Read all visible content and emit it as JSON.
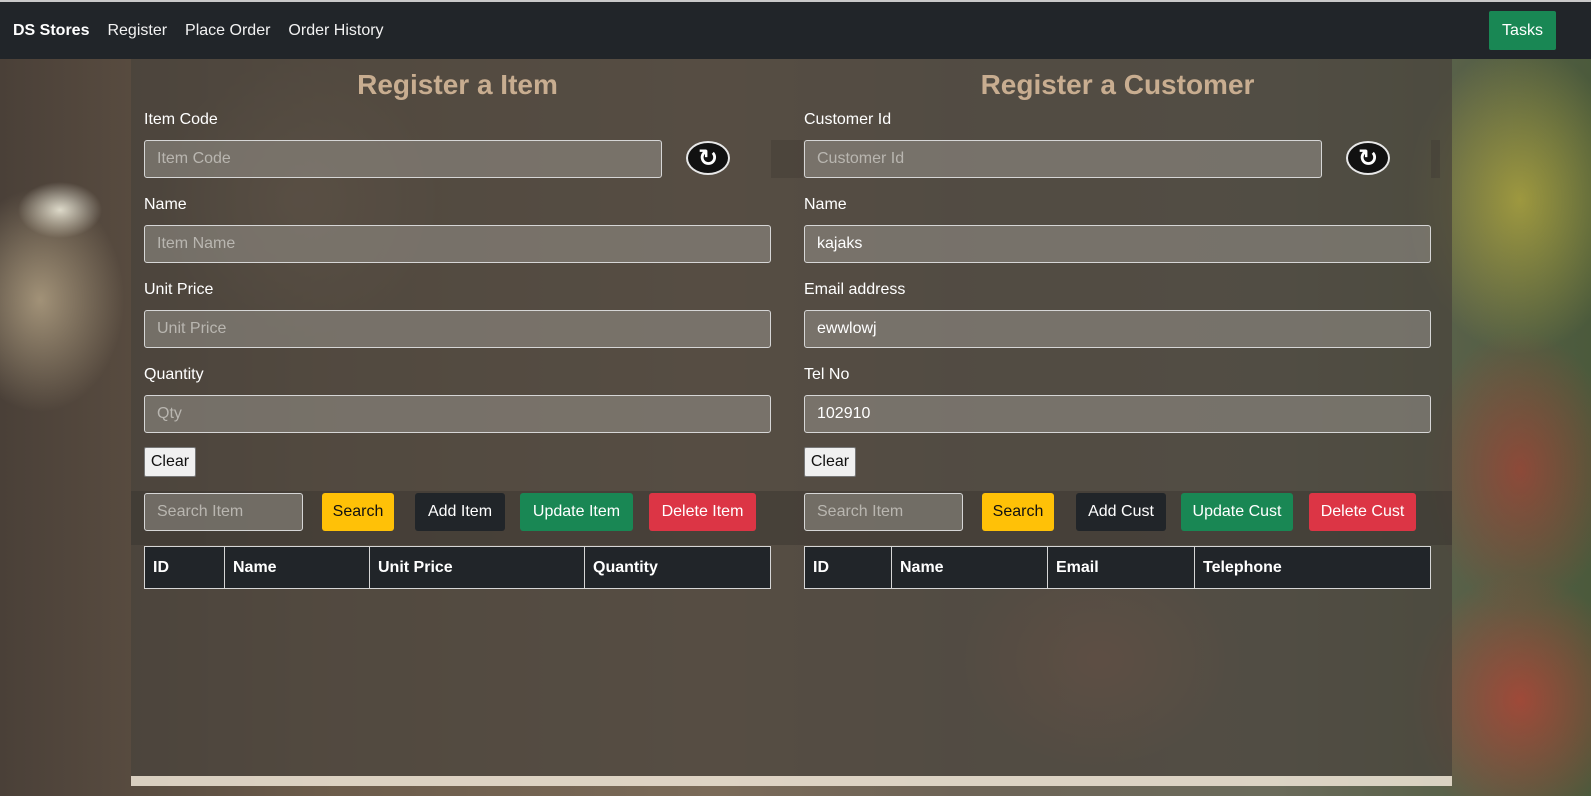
{
  "navbar": {
    "brand": "DS Stores",
    "links": [
      "Register",
      "Place Order",
      "Order History"
    ],
    "tasks_label": "Tasks"
  },
  "item_form": {
    "title": "Register a Item",
    "code_label": "Item Code",
    "code_placeholder": "Item Code",
    "name_label": "Name",
    "name_placeholder": "Item Name",
    "price_label": "Unit Price",
    "price_placeholder": "Unit Price",
    "qty_label": "Quantity",
    "qty_placeholder": "Qty",
    "clear_label": "Clear",
    "search_placeholder": "Search Item",
    "search_label": "Search",
    "add_label": "Add Item",
    "update_label": "Update Item",
    "delete_label": "Delete Item",
    "table_headers": [
      "ID",
      "Name",
      "Unit Price",
      "Quantity"
    ]
  },
  "customer_form": {
    "title": "Register a Customer",
    "id_label": "Customer Id",
    "id_placeholder": "Customer Id",
    "name_label": "Name",
    "name_value": "kajaks",
    "email_label": "Email address",
    "email_value": "ewwlowj",
    "tel_label": "Tel No",
    "tel_value": "102910",
    "clear_label": "Clear",
    "search_placeholder": "Search Item",
    "search_label": "Search",
    "add_label": "Add Cust",
    "update_label": "Update Cust",
    "delete_label": "Delete Cust",
    "table_headers": [
      "ID",
      "Name",
      "Email",
      "Telephone"
    ]
  },
  "icons": {
    "refresh": "refresh-icon"
  },
  "colors": {
    "navbar": "#212529",
    "title": "#c8ad90",
    "success": "#198754",
    "warning": "#ffc107",
    "danger": "#dc3545"
  }
}
